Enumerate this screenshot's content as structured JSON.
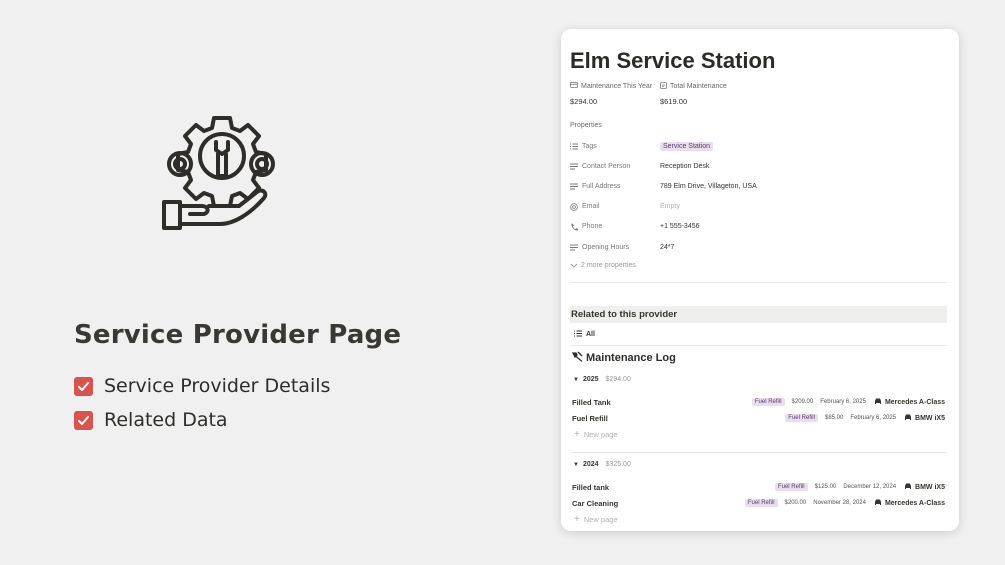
{
  "promo": {
    "title": "Service Provider Page",
    "checklist": [
      "Service Provider Details",
      "Related Data"
    ],
    "check_color": "#d9534f"
  },
  "page": {
    "title": "Elm Service Station",
    "rollups": [
      {
        "label": "Maintenance This Year",
        "value": "$294.00",
        "icon": "wallet-icon"
      },
      {
        "label": "Total Maintenance",
        "value": "$619.00",
        "icon": "receipt-icon"
      }
    ],
    "properties_heading": "Properties",
    "properties": [
      {
        "name": "Tags",
        "value": "Service Station",
        "icon": "list-icon",
        "is_tag": true
      },
      {
        "name": "Contact Person",
        "value": "Reception Desk",
        "icon": "text-icon"
      },
      {
        "name": "Full Address",
        "value": "789 Elm Drive, Villageton, USA",
        "icon": "text-icon"
      },
      {
        "name": "Email",
        "value": "Empty",
        "icon": "at-icon",
        "empty": true
      },
      {
        "name": "Phone",
        "value": "+1 555-3456",
        "icon": "phone-icon"
      },
      {
        "name": "Opening Hours",
        "value": "24*7",
        "icon": "text-icon"
      }
    ],
    "more_properties": "2 more properties",
    "tag_color": "#e8deee"
  },
  "related": {
    "heading": "Related to this provider",
    "view_label": "All",
    "db_title": "Maintenance Log",
    "groups": [
      {
        "year": "2025",
        "sum": "$294.00",
        "entries": [
          {
            "name": "Filled Tank",
            "tag": "Fuel Refill",
            "amount": "$209.00",
            "date": "February 6, 2025",
            "car": "Mercedes A-Class"
          },
          {
            "name": "Fuel Refill",
            "tag": "Fuel Refill",
            "amount": "$85.00",
            "date": "February 6, 2025",
            "car": "BMW iX5"
          }
        ],
        "new_page": "New page"
      },
      {
        "year": "2024",
        "sum": "$325.00",
        "entries": [
          {
            "name": "Filled tank",
            "tag": "Fuel Refill",
            "amount": "$125.00",
            "date": "December 12, 2024",
            "car": "BMW iX5"
          },
          {
            "name": "Car Cleaning",
            "tag": "Fuel Refill",
            "amount": "$200.00",
            "date": "November 28, 2024",
            "car": "Mercedes A-Class"
          }
        ],
        "new_page": "New page"
      }
    ]
  }
}
